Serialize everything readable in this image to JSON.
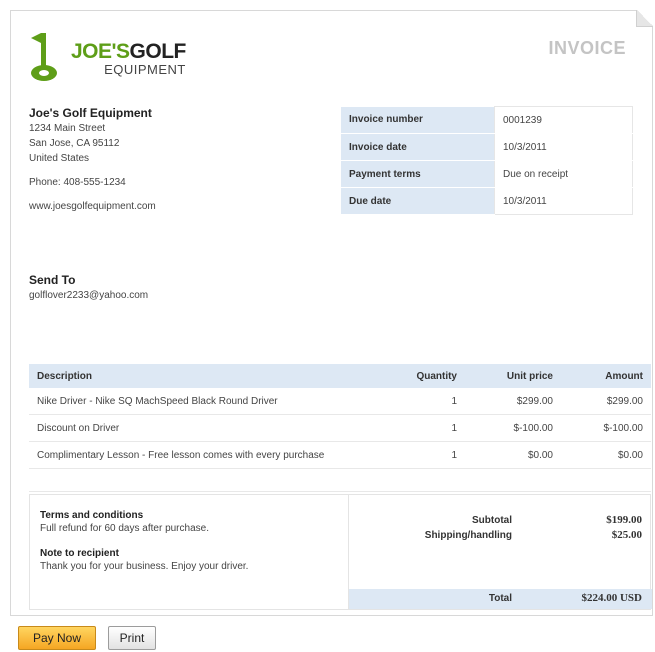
{
  "logo": {
    "line1_a": "JOE'S",
    "line1_b": "GOLF",
    "line2": "EQUIPMENT"
  },
  "document_title": "INVOICE",
  "company": {
    "name": "Joe's Golf Equipment",
    "address1": "1234 Main Street",
    "address2": "San Jose, CA 95112",
    "country": "United States",
    "phone": "Phone: 408-555-1234",
    "website": "www.joesgolfequipment.com"
  },
  "meta": [
    {
      "label": "Invoice number",
      "value": "0001239"
    },
    {
      "label": "Invoice date",
      "value": "10/3/2011"
    },
    {
      "label": "Payment terms",
      "value": "Due on receipt"
    },
    {
      "label": "Due date",
      "value": "10/3/2011"
    }
  ],
  "send_to": {
    "heading": "Send To",
    "email": "golflover2233@yahoo.com"
  },
  "items": {
    "headers": {
      "description": "Description",
      "quantity": "Quantity",
      "unit_price": "Unit price",
      "amount": "Amount"
    },
    "rows": [
      {
        "description": "Nike Driver - Nike SQ MachSpeed Black Round Driver",
        "quantity": "1",
        "unit_price": "$299.00",
        "amount": "$299.00"
      },
      {
        "description": "Discount on Driver",
        "quantity": "1",
        "unit_price": "$-100.00",
        "amount": "$-100.00"
      },
      {
        "description": "Complimentary Lesson - Free lesson comes with every purchase",
        "quantity": "1",
        "unit_price": "$0.00",
        "amount": "$0.00"
      }
    ]
  },
  "terms": {
    "heading": "Terms and conditions",
    "text": "Full refund for 60 days after purchase.",
    "note_heading": "Note to recipient",
    "note_text": "Thank you for your business. Enjoy your driver."
  },
  "totals": {
    "subtotal_label": "Subtotal",
    "subtotal": "$199.00",
    "shipping_label": "Shipping/handling",
    "shipping": "$25.00",
    "total_label": "Total",
    "total": "$224.00 USD"
  },
  "buttons": {
    "pay_now": "Pay Now",
    "print": "Print"
  },
  "colors": {
    "brand_green": "#5e9e18",
    "header_blue": "#dde8f4",
    "pay_button": "#f5a623"
  }
}
